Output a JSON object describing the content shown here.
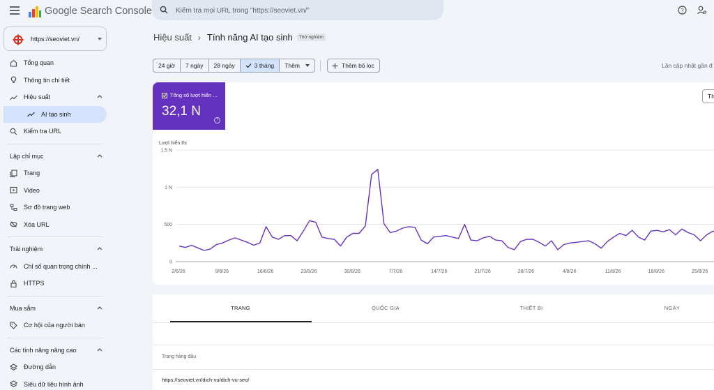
{
  "app": {
    "brand": "Google Search Console",
    "search_placeholder": "Kiểm tra mọi URL trong \"https://seoviet.vn/\""
  },
  "property": {
    "label": "https://seoviet.vn/"
  },
  "sidebar": {
    "top": [
      {
        "label": "Tổng quan",
        "icon": "home-icon"
      },
      {
        "label": "Thông tin chi tiết",
        "icon": "lightbulb-icon"
      },
      {
        "label": "Hiệu suất",
        "icon": "trending-icon"
      },
      {
        "label": "AI tạo sinh",
        "icon": "trending-icon"
      },
      {
        "label": "Kiểm tra URL",
        "icon": "search-icon"
      }
    ],
    "sections": [
      {
        "title": "Lập chỉ mục",
        "items": [
          "Trang",
          "Video",
          "Sơ đồ trang web",
          "Xóa URL"
        ]
      },
      {
        "title": "Trải nghiệm",
        "items": [
          "Chỉ số quan trọng chính ...",
          "HTTPS"
        ]
      },
      {
        "title": "Mua sắm",
        "items": [
          "Cơ hội của người bán"
        ]
      },
      {
        "title": "Các tính năng nâng cao",
        "items": [
          "Đường dẫn",
          "Siêu dữ liệu hình ảnh"
        ]
      }
    ]
  },
  "breadcrumb": {
    "parent": "Hiệu suất",
    "current": "Tính năng AI tạo sinh",
    "badge": "Thử nghiệm"
  },
  "date_ranges": [
    "24 giờ",
    "7 ngày",
    "28 ngày",
    "3 tháng",
    "Thêm"
  ],
  "selected_range": "3 tháng",
  "filter_label": "Thêm bộ lọc",
  "updated_text": "Lần cập nhật gần đ",
  "metric": {
    "label": "Tổng số lượt hiển ...",
    "value": "32,1 N",
    "color": "#6532c0"
  },
  "card_button": "Th",
  "chart_data": {
    "type": "line",
    "ylabel": "Lượt hiển thị",
    "y_ticks": [
      "1,5 N",
      "1 N",
      "500",
      "0"
    ],
    "ylim": [
      0,
      1500
    ],
    "x_ticks": [
      "2/6/26",
      "9/6/26",
      "16/6/26",
      "23/6/26",
      "30/6/26",
      "7/7/26",
      "14/7/26",
      "21/7/26",
      "28/7/26",
      "4/8/26",
      "11/8/26",
      "18/8/26",
      "25/8/26"
    ],
    "grid": true,
    "series": [
      {
        "values": [
          210,
          190,
          220,
          185,
          150,
          170,
          230,
          250,
          290,
          320,
          290,
          260,
          220,
          250,
          470,
          330,
          300,
          350,
          350,
          280,
          410,
          550,
          530,
          330,
          310,
          300,
          210,
          330,
          380,
          380,
          480,
          1170,
          1240,
          510,
          390,
          410,
          450,
          470,
          460,
          290,
          240,
          330,
          340,
          350,
          330,
          310,
          500,
          290,
          280,
          320,
          340,
          290,
          280,
          190,
          160,
          270,
          300,
          300,
          260,
          210,
          280,
          160,
          230,
          250,
          260,
          270,
          280,
          240,
          180,
          270,
          330,
          380,
          350,
          420,
          330,
          290,
          410,
          420,
          400,
          430,
          360,
          440,
          390,
          360,
          280,
          360,
          410,
          380,
          440,
          530,
          480
        ]
      }
    ]
  },
  "tabs": [
    "TRANG",
    "QUỐC GIA",
    "THIẾT BỊ",
    "NGÀY"
  ],
  "table": {
    "header": "Trang hàng đầu",
    "rows": [
      "https://seoviet.vn/dich-vu/dich-vu-seo/"
    ]
  }
}
